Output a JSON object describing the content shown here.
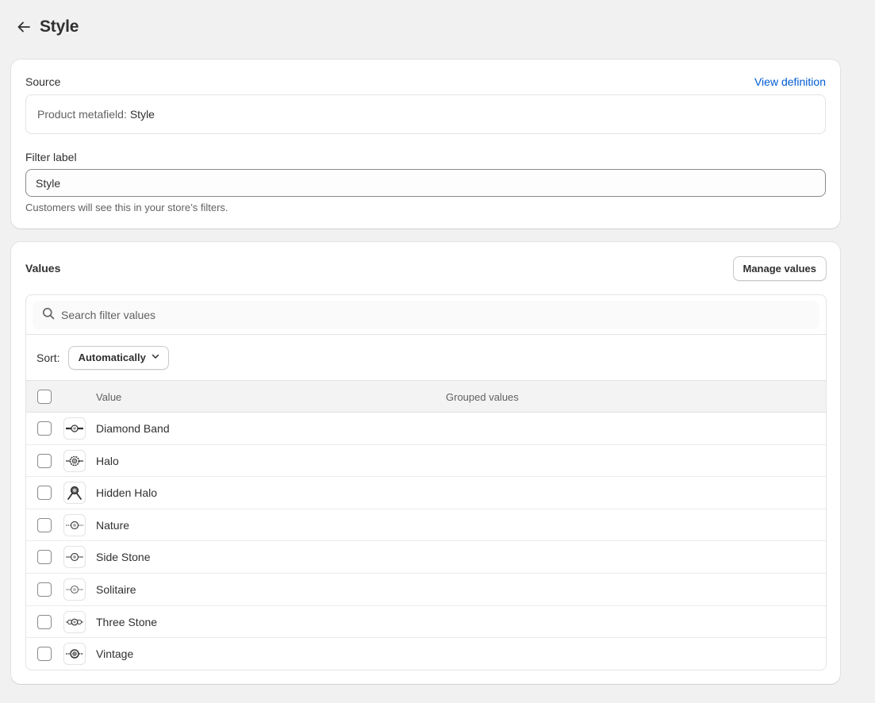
{
  "page": {
    "title": "Style"
  },
  "source": {
    "label": "Source",
    "link_label": "View definition",
    "prefix": "Product metafield:",
    "value": "Style"
  },
  "filter_label": {
    "label": "Filter label",
    "value": "Style",
    "help": "Customers will see this in your store’s filters."
  },
  "values": {
    "title": "Values",
    "manage_label": "Manage values",
    "search_placeholder": "Search filter values",
    "sort_label": "Sort:",
    "sort_value": "Automatically",
    "columns": {
      "value": "Value",
      "grouped": "Grouped values"
    },
    "rows": [
      {
        "name": "Diamond Band",
        "icon": "ring-band-icon"
      },
      {
        "name": "Halo",
        "icon": "ring-halo-icon"
      },
      {
        "name": "Hidden Halo",
        "icon": "ring-hidden-halo-icon"
      },
      {
        "name": "Nature",
        "icon": "ring-nature-icon"
      },
      {
        "name": "Side Stone",
        "icon": "ring-side-stone-icon"
      },
      {
        "name": "Solitaire",
        "icon": "ring-solitaire-icon"
      },
      {
        "name": "Three Stone",
        "icon": "ring-three-stone-icon"
      },
      {
        "name": "Vintage",
        "icon": "ring-vintage-icon"
      }
    ]
  },
  "colors": {
    "background": "#f1f1f1",
    "card": "#ffffff",
    "link": "#005bd3",
    "text": "#303030",
    "subdued": "#616161"
  }
}
